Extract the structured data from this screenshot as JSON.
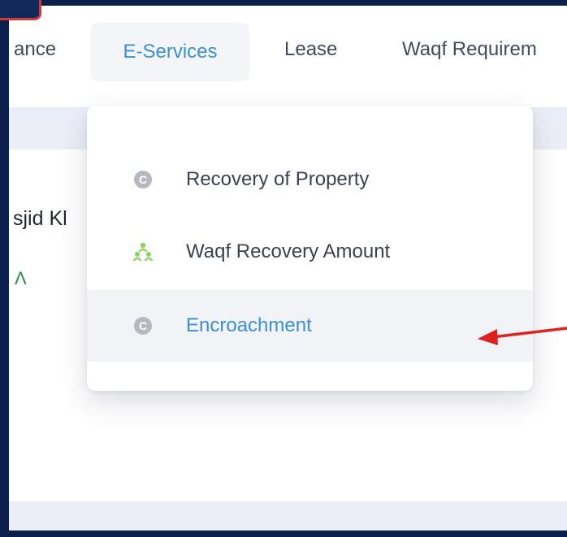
{
  "navbar": {
    "items": [
      {
        "label": "ance"
      },
      {
        "label": "E-Services",
        "active": true
      },
      {
        "label": "Lease"
      },
      {
        "label": "Waqf Requirem"
      }
    ]
  },
  "main": {
    "partial_heading": "sjid Kl",
    "partial_glyph": "Λ"
  },
  "dropdown": {
    "items": [
      {
        "label": "Recovery of Property",
        "icon": "c-circle-icon"
      },
      {
        "label": "Waqf Recovery Amount",
        "icon": "people-network-icon"
      },
      {
        "label": "Encroachment",
        "icon": "c-circle-icon",
        "highlighted": true
      }
    ],
    "icon_letter": "C"
  },
  "colors": {
    "frame_border": "#0b1f4d",
    "active_nav_text": "#3b8fd6",
    "highlight_bg": "#f1f3f7",
    "annotation_arrow": "#e0201c",
    "people_icon": "#8bd35a"
  }
}
